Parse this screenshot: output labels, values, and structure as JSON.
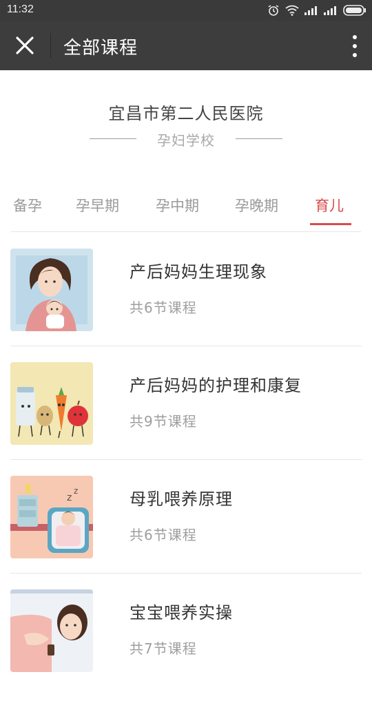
{
  "status": {
    "time": "11:32"
  },
  "header": {
    "title": "全部课程"
  },
  "hospital": {
    "name": "宜昌市第二人民医院",
    "school": "孕妇学校"
  },
  "tabs": [
    {
      "label": "备孕",
      "active": false
    },
    {
      "label": "孕早期",
      "active": false
    },
    {
      "label": "孕中期",
      "active": false
    },
    {
      "label": "孕晚期",
      "active": false
    },
    {
      "label": "育儿",
      "active": true
    }
  ],
  "courses": [
    {
      "title": "产后妈妈生理现象",
      "subtitle": "共6节课程",
      "thumb": "mother-holding-baby"
    },
    {
      "title": "产后妈妈的护理和康复",
      "subtitle": "共9节课程",
      "thumb": "cartoon-foods"
    },
    {
      "title": "母乳喂养原理",
      "subtitle": "共6节课程",
      "thumb": "sleeping-baby-crib"
    },
    {
      "title": "宝宝喂养实操",
      "subtitle": "共7节课程",
      "thumb": "mother-feeding"
    }
  ],
  "colors": {
    "header": "#3d3d3d",
    "accent": "#d94a4a"
  }
}
